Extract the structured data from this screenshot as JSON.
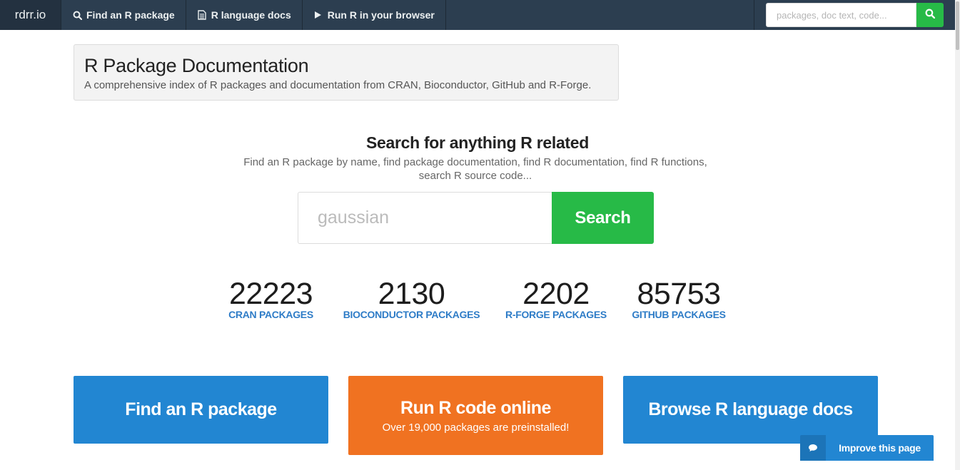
{
  "navbar": {
    "brand": "rdrr.io",
    "items": [
      {
        "label": "Find an R package",
        "icon": "search-icon"
      },
      {
        "label": "R language docs",
        "icon": "document-icon"
      },
      {
        "label": "Run R in your browser",
        "icon": "play-icon"
      }
    ],
    "search": {
      "placeholder": "packages, doc text, code..."
    }
  },
  "header": {
    "title": "R Package Documentation",
    "subtitle": "A comprehensive index of R packages and documentation from CRAN, Bioconductor, GitHub and R-Forge."
  },
  "search": {
    "heading": "Search for anything R related",
    "description": "Find an R package by name, find package documentation, find R documentation, find R functions, search R source code...",
    "placeholder": "gaussian",
    "button_label": "Search"
  },
  "stats": [
    {
      "value": "22223",
      "label": "CRAN PACKAGES"
    },
    {
      "value": "2130",
      "label": "BIOCONDUCTOR PACKAGES"
    },
    {
      "value": "2202",
      "label": "R-FORGE PACKAGES"
    },
    {
      "value": "85753",
      "label": "GITHUB PACKAGES"
    }
  ],
  "cards": [
    {
      "title": "Find an R package"
    },
    {
      "title": "Run R code online",
      "subtitle": "Over 19,000 packages are preinstalled!"
    },
    {
      "title": "Browse R language docs"
    }
  ],
  "improve": {
    "label": "Improve this page",
    "icon": "comment-icon"
  },
  "colors": {
    "navbar": "#2c3e50",
    "green": "#27ba47",
    "blue": "#2286d2",
    "orange": "#f07221",
    "link_blue": "#2e7cc7"
  }
}
